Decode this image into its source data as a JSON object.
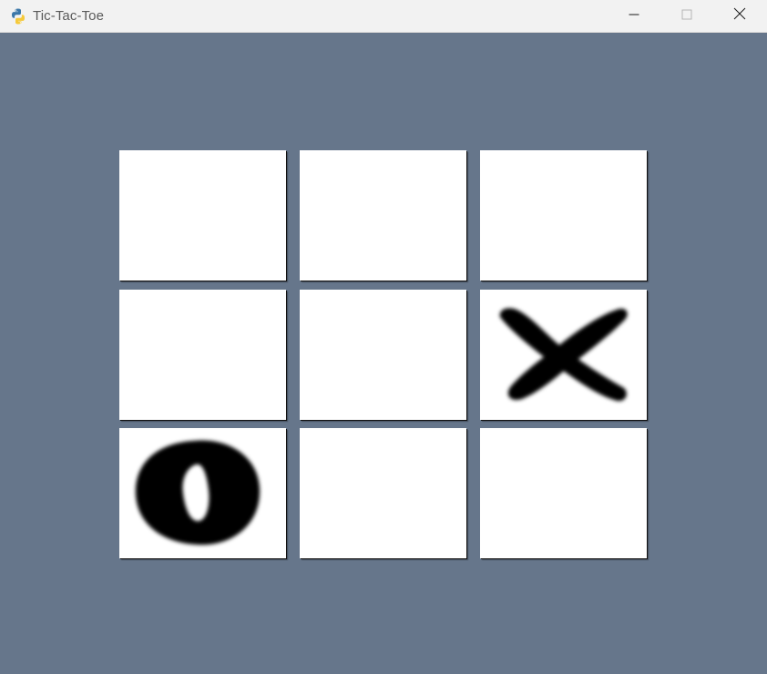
{
  "window": {
    "title": "Tic-Tac-Toe",
    "app_icon": "python-icon",
    "controls": {
      "minimize": "minimize-icon",
      "maximize": "maximize-icon",
      "close": "close-icon"
    }
  },
  "colors": {
    "background": "#66768b",
    "cell": "#ffffff",
    "mark": "#000000"
  },
  "board": {
    "cells": [
      {
        "row": 1,
        "col": 1,
        "mark": ""
      },
      {
        "row": 1,
        "col": 2,
        "mark": ""
      },
      {
        "row": 1,
        "col": 3,
        "mark": ""
      },
      {
        "row": 2,
        "col": 1,
        "mark": ""
      },
      {
        "row": 2,
        "col": 2,
        "mark": ""
      },
      {
        "row": 2,
        "col": 3,
        "mark": "X"
      },
      {
        "row": 3,
        "col": 1,
        "mark": "O"
      },
      {
        "row": 3,
        "col": 2,
        "mark": ""
      },
      {
        "row": 3,
        "col": 3,
        "mark": ""
      }
    ]
  }
}
